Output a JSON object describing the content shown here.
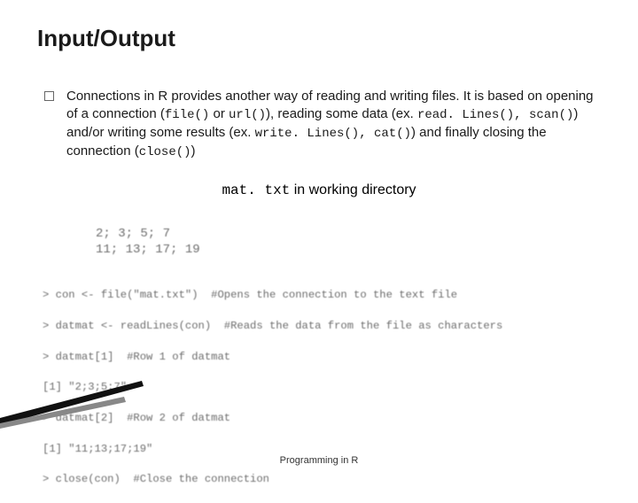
{
  "title": "Input/Output",
  "paragraph": {
    "p1": "Connections in R provides another way of reading and writing files. It is based on opening of a connection (",
    "code1": "file()",
    "p2": " or ",
    "code2": "url()",
    "p3": "), reading some data (ex. ",
    "code3": "read. Lines(), scan()",
    "p4": ") and/or writing some results (ex. ",
    "code4": "write. Lines(), cat()",
    "p5": ") and finally closing the connection (",
    "code5": "close()",
    "p6": ")"
  },
  "caption": {
    "file": "mat. txt",
    "rest": " in working directory"
  },
  "matbox": {
    "l1": "2; 3; 5; 7",
    "l2": "11; 13; 17; 19"
  },
  "code": {
    "l1": "> con <- file(\"mat.txt\")  #Opens the connection to the text file",
    "l2": "> datmat <- readLines(con)  #Reads the data from the file as characters",
    "l3": "> datmat[1]  #Row 1 of datmat",
    "l4": "[1] \"2;3;5;7\"",
    "l5": "> datmat[2]  #Row 2 of datmat",
    "l6": "[1] \"11;13;17;19\"",
    "l7": "> close(con)  #Close the connection"
  },
  "footer": "Programming in R"
}
